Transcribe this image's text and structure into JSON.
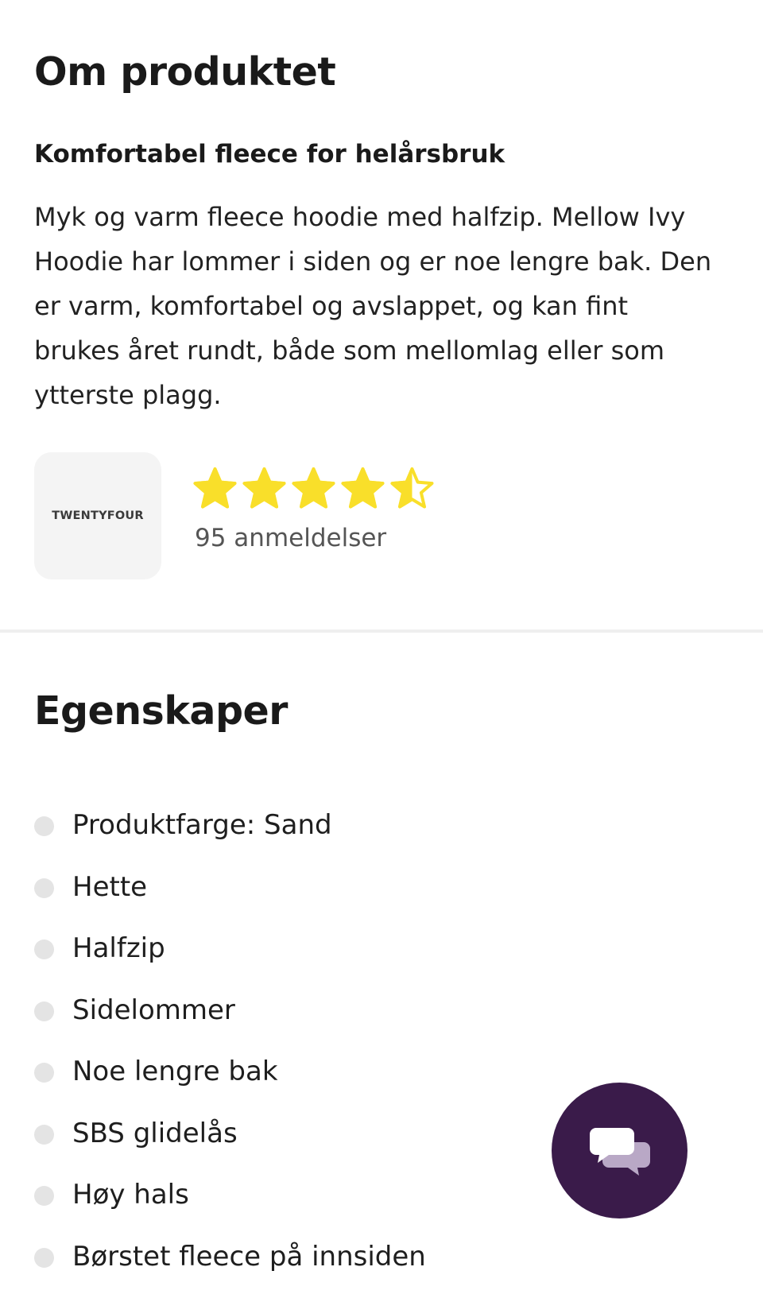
{
  "about": {
    "title": "Om produktet",
    "subtitle": "Komfortabel fleece for helårsbruk",
    "description_lines": [
      "Myk og varm fleece hoodie med halfzip. Mellow Ivy",
      "Hoodie har lommer i siden og er noe lengre bak. Den",
      "er varm, komfortabel og avslappet, og kan fint",
      "brukes året rundt, både som mellomlag eller som",
      "ytterste plagg."
    ]
  },
  "brand": {
    "logo_text": "TWENTYFOUR"
  },
  "rating": {
    "value": 4.5,
    "max": 5,
    "reviews_label": "95 anmeldelser",
    "star_color": "#f9df2a"
  },
  "features": {
    "title": "Egenskaper",
    "items": [
      "Produktfarge: Sand",
      "Hette",
      "Halfzip",
      "Sidelommer",
      "Noe lengre bak",
      "SBS glidelås",
      "Høy hals",
      "Børstet fleece på innsiden"
    ]
  },
  "chat": {
    "icon": "chat-bubbles-icon",
    "background": "#3a1b4a"
  }
}
